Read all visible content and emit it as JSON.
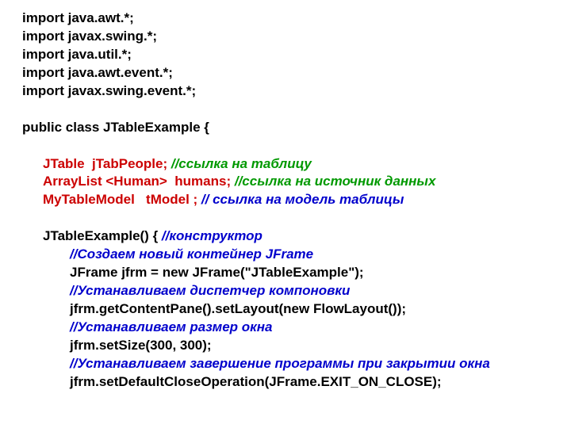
{
  "l1": "import java.awt.*;",
  "l2": "import javax.swing.*;",
  "l3": "import java.util.*;",
  "l4": "import java.awt.event.*;",
  "l5": "import javax.swing.event.*;",
  "blank1": " ",
  "l6": "public class JTableExample {",
  "blank2": " ",
  "l7a": "JTable  jTabPeople;",
  "l7b": " //ссылка на таблицу",
  "l8a": "ArrayList <Human>",
  "l8b": "  humans;",
  "l8c": " //ссылка на источник данных",
  "l9a": "MyTableModel   tModel ;",
  "l9b": " // ссылка на модель таблицы",
  "blank3": " ",
  "l10a": "JTableExample() {",
  "l10b": " //конструктор",
  "l11": "//Создаем новый контейнер JFrame",
  "l12": "JFrame jfrm = new JFrame(\"JTableExample\");",
  "l13": "//Устанавливаем диспетчер компоновки",
  "l14": "jfrm.getContentPane().setLayout(new FlowLayout());",
  "l15": "//Устанавливаем размер окна",
  "l16": "jfrm.setSize(300, 300);",
  "l17": "//Устанавливаем завершение программы при закрытии окна",
  "l18": "jfrm.setDefaultCloseOperation(JFrame.EXIT_ON_CLOSE);"
}
